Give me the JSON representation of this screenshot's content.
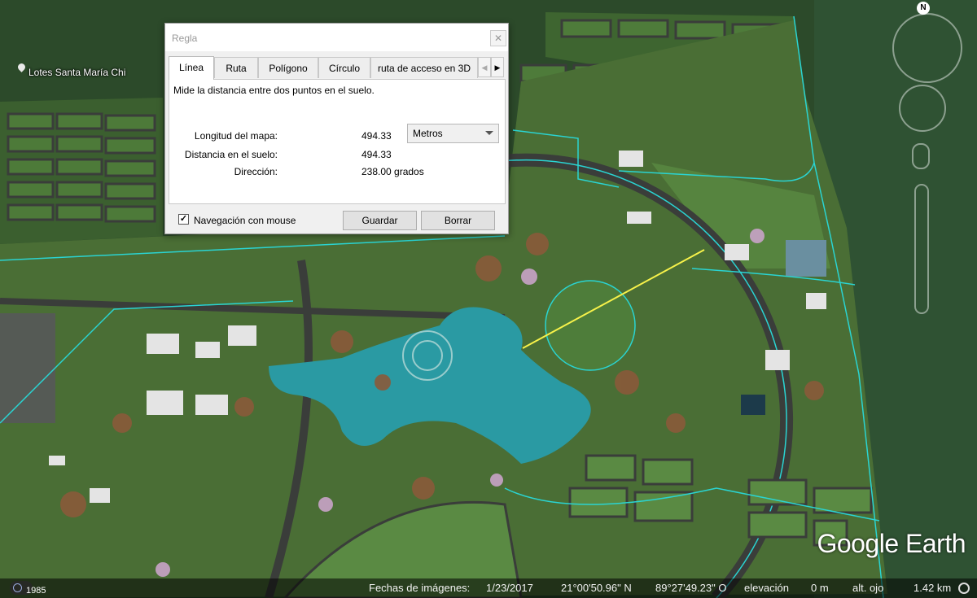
{
  "map": {
    "place_label": "Lotes Santa María Chi",
    "brand": "Google Earth",
    "compass_north": "N",
    "colors": {
      "forest": "#2c4a2a",
      "lawn": "#4f7d3a",
      "road": "#3a3d3a",
      "water": "#2a9aa3",
      "boundary": "#2ad4d2",
      "measure_line": "#f7f24a"
    }
  },
  "status_bar": {
    "year": "1985",
    "imagery_date_label": "Fechas de imágenes:",
    "imagery_date": "1/23/2017",
    "latitude": "21°00'50.96\" N",
    "longitude": "89°27'49.23\" O",
    "elevation_label": "elevación",
    "elevation": "0 m",
    "eye_alt_label": "alt. ojo",
    "eye_alt": "1.42 km"
  },
  "dialog": {
    "title": "Regla",
    "close_symbol": "✕",
    "tabs": [
      {
        "label": "Línea",
        "active": true
      },
      {
        "label": "Ruta"
      },
      {
        "label": "Polígono"
      },
      {
        "label": "Círculo"
      },
      {
        "label": "ruta de acceso en 3D"
      }
    ],
    "description": "Mide la distancia entre dos puntos en el suelo.",
    "map_length_label": "Longitud del mapa:",
    "map_length_value": "494.33",
    "units": "Metros",
    "ground_distance_label": "Distancia en el suelo:",
    "ground_distance_value": "494.33",
    "heading_label": "Dirección:",
    "heading_value": "238.00 grados",
    "mouse_nav_label": "Navegación con mouse",
    "mouse_nav_checked": true,
    "save_button": "Guardar",
    "clear_button": "Borrar"
  }
}
